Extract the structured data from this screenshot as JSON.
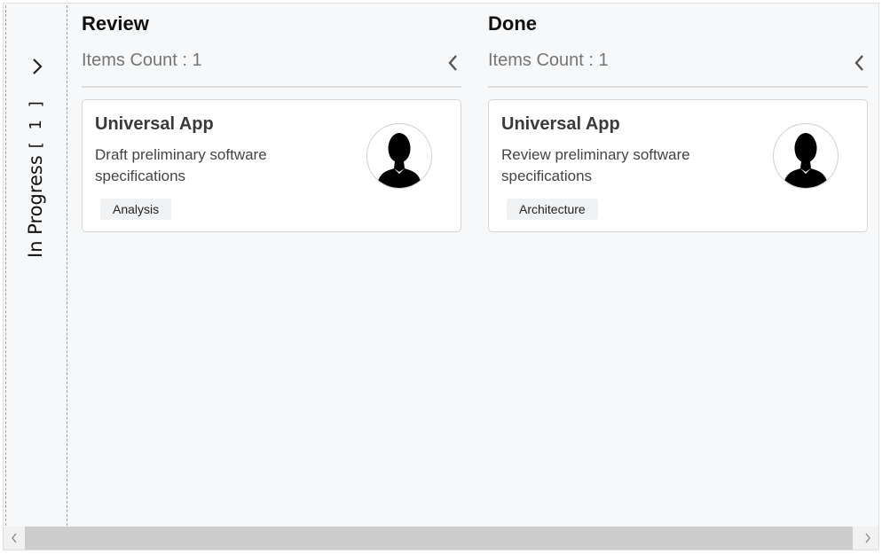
{
  "collapsed_column": {
    "title": "In Progress",
    "count": "[ 1 ]"
  },
  "columns": [
    {
      "title": "Review",
      "count_label": "Items Count : 1",
      "card": {
        "title": "Universal App",
        "description": "Draft preliminary software specifications",
        "tag": "Analysis"
      }
    },
    {
      "title": "Done",
      "count_label": "Items Count : 1",
      "card": {
        "title": "Universal App",
        "description": "Review preliminary software specifications",
        "tag": "Architecture"
      }
    }
  ],
  "icons": {
    "expand": "chevron-right-icon",
    "collapse": "chevron-left-icon",
    "avatar": "user-silhouette-icon"
  },
  "scrollbar": {
    "position_percent": 0
  }
}
